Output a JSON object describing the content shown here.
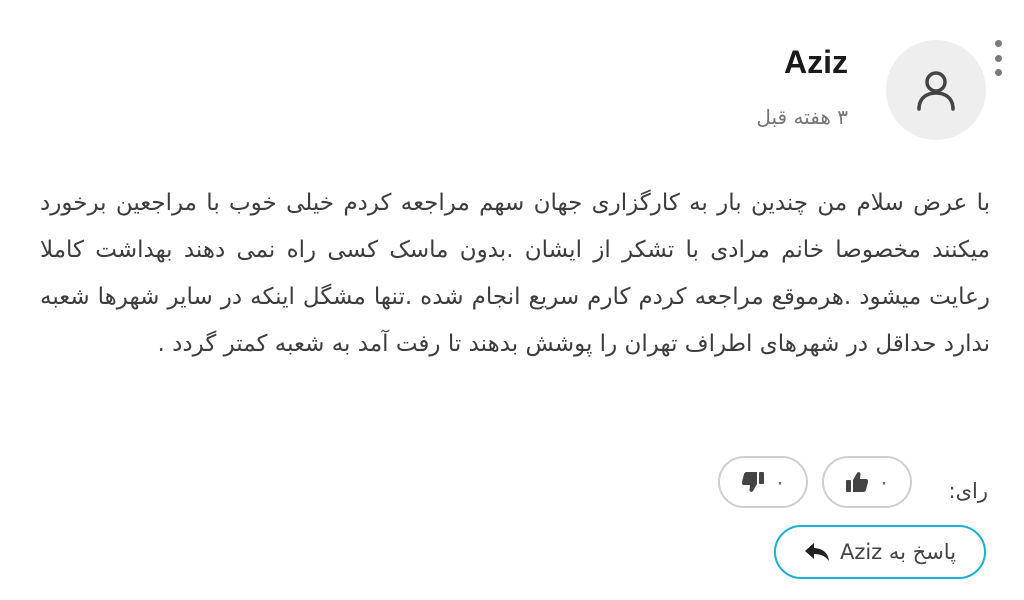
{
  "comment": {
    "author": "Aziz",
    "time_ago": "۳ هفته قبل",
    "avatar_icon": "user-icon",
    "menu_icon": "more-vertical-icon",
    "body": "با عرض سلام من چندین بار به کارگزاری جهان سهم مراجعه کردم خیلی خوب با مراجعین برخورد میکنند مخصوصا خانم مرادی با تشکر از ایشان .بدون ماسک کسی راه نمی دهند بهداشت کاملا رعایت میشود .هرموقع مراجعه کردم کارم سریع انجام شده .تنها مشگل اینکه در سایر شهرها شعبه ندارد حداقل در شهرهای اطراف تهران را پوشش بدهند تا رفت آمد به شعبه کمتر گردد ."
  },
  "votes": {
    "label": "رای:",
    "up": {
      "count": "۰",
      "icon": "thumbs-up-icon"
    },
    "down": {
      "count": "۰",
      "icon": "thumbs-down-icon"
    }
  },
  "reply": {
    "label": "پاسخ به Aziz",
    "icon": "reply-arrow-icon",
    "accent_color": "#19b1d4"
  },
  "colors": {
    "avatar_bg": "#eeeeee",
    "text": "#3d3d3d",
    "muted": "#757575"
  }
}
